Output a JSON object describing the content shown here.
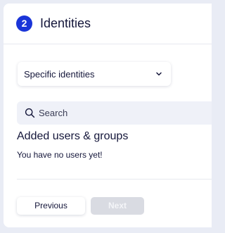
{
  "step": {
    "number": "2",
    "title": "Identities"
  },
  "identity_select": {
    "value": "Specific identities"
  },
  "search": {
    "placeholder": "Search"
  },
  "added_section": {
    "title": "Added users & groups",
    "empty_message": "You have no users yet!"
  },
  "footer": {
    "previous_label": "Previous",
    "next_label": "Next",
    "next_disabled": true
  },
  "icons": {
    "dropdown": "chevron-down-icon",
    "search": "search-icon"
  },
  "colors": {
    "accent": "#1a35d8",
    "text": "#14163a",
    "page_background": "#e9ecf5",
    "search_background": "#eff1f8",
    "disabled_button": "#d9dbe2"
  }
}
